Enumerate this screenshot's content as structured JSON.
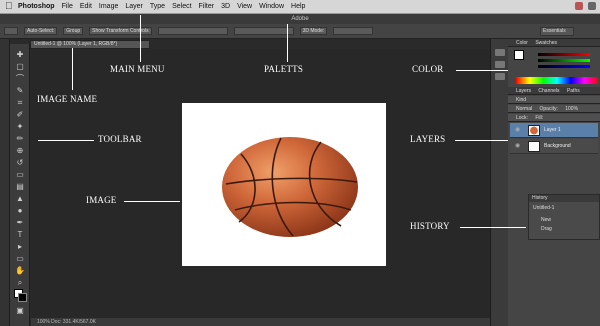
{
  "menubar": {
    "apple": "",
    "items": [
      "Photoshop",
      "File",
      "Edit",
      "Image",
      "Layer",
      "Type",
      "Select",
      "Filter",
      "3D",
      "View",
      "Window",
      "Help"
    ]
  },
  "window": {
    "title": "Adobe"
  },
  "options": {
    "auto_select": "Auto-Select:",
    "group": "Group",
    "show_transform": "Show Transform Controls",
    "mode_3d": "3D Mode:",
    "workspace": "Essentials"
  },
  "document": {
    "tab": "Untitled-1 @ 100% (Layer 1, RGB/8*)"
  },
  "status": {
    "text": "100%    Doc: 331.4K/567.0K"
  },
  "panels": {
    "color_tabs": [
      "Color",
      "Swatches"
    ],
    "adjust_tabs": [
      "Layers",
      "Channels",
      "Paths"
    ],
    "layer_filter": "Kind",
    "layer_mode": "Normal",
    "opacity_label": "Opacity:",
    "opacity_value": "100%",
    "fill_label": "Fill:",
    "lock_label": "Lock:",
    "layers": [
      "Layer 1",
      "Background"
    ],
    "history_title": "History",
    "history_items": [
      "Untitled-1",
      "New",
      "Drag"
    ]
  },
  "annotations": {
    "main_menu": "MAIN MENU",
    "palettes": "PALETTS",
    "color": "COLOR",
    "image_name": "IMAGE NAME",
    "toolbar": "TOOLBAR",
    "layers": "LAYERS",
    "image": "IMAGE",
    "history": "HISTORY"
  },
  "colors": {
    "annotation": "#ffffff",
    "workspace_bg": "#282828",
    "ball": "#c4562a"
  }
}
